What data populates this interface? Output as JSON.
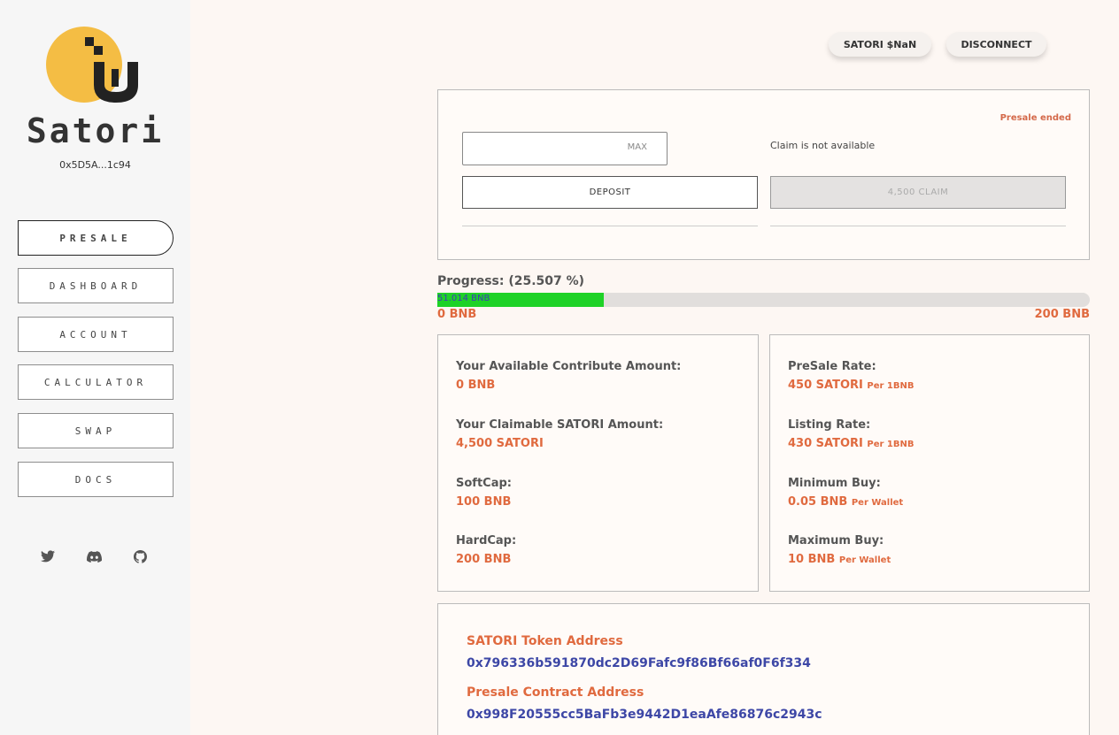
{
  "brand": {
    "name": "Satori",
    "wallet_short": "0x5D5A...1c94"
  },
  "nav": {
    "items": [
      {
        "label": "PRESALE",
        "active": true
      },
      {
        "label": "DASHBOARD",
        "active": false
      },
      {
        "label": "ACCOUNT",
        "active": false
      },
      {
        "label": "CALCULATOR",
        "active": false
      },
      {
        "label": "SWAP",
        "active": false
      },
      {
        "label": "DOCS",
        "active": false
      }
    ]
  },
  "socials": [
    "twitter-icon",
    "discord-icon",
    "github-icon"
  ],
  "header": {
    "price_label": "SATORI $NaN",
    "disconnect_label": "DISCONNECT"
  },
  "deposit": {
    "status": "Presale ended",
    "input_value": "",
    "max_label": "MAX",
    "claim_info": "Claim is not available",
    "deposit_label": "DEPOSIT",
    "claim_label": "4,500 CLAIM"
  },
  "progress": {
    "label": "Progress: (25.507 %)",
    "percent": 25.507,
    "fill_text": "51.014 BNB",
    "min_label": "0 BNB",
    "max_label": "200 BNB"
  },
  "info_left": [
    {
      "label": "Your Available Contribute Amount:",
      "value": "0 BNB",
      "unit": ""
    },
    {
      "label": "Your Claimable SATORI Amount:",
      "value": "4,500 SATORI",
      "unit": ""
    },
    {
      "label": "SoftCap:",
      "value": "100 BNB",
      "unit": ""
    },
    {
      "label": "HardCap:",
      "value": "200 BNB",
      "unit": ""
    }
  ],
  "info_right": [
    {
      "label": "PreSale Rate:",
      "value": "450 SATORI",
      "unit": "Per 1BNB"
    },
    {
      "label": "Listing Rate:",
      "value": "430 SATORI",
      "unit": "Per 1BNB"
    },
    {
      "label": "Minimum Buy:",
      "value": "0.05 BNB",
      "unit": "Per Wallet"
    },
    {
      "label": "Maximum Buy:",
      "value": "10 BNB",
      "unit": "Per Wallet"
    }
  ],
  "addresses": {
    "token_label": "SATORI Token Address",
    "token_value": "0x796336b591870dc2D69Fafc9f86Bf66af0F6f334",
    "contract_label": "Presale Contract Address",
    "contract_value": "0x998F20555cc5BaFb3e9442D1eaAfe86876c2943c"
  },
  "colors": {
    "accent": "#e06a3f",
    "link": "#3d47a6",
    "progress": "#1ed227",
    "logo": "#f4bd44"
  }
}
